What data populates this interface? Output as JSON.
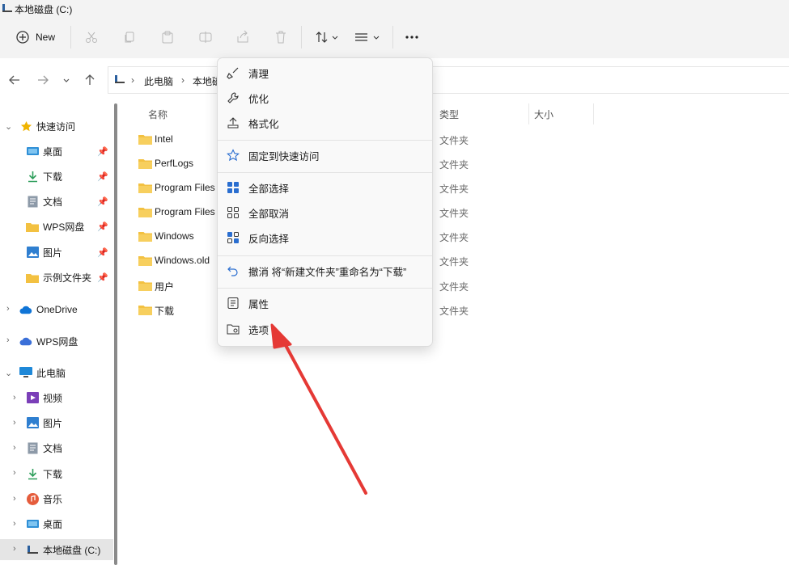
{
  "window": {
    "title": "本地磁盘 (C:)"
  },
  "toolbar": {
    "new_label": "New",
    "icons": [
      "add-icon",
      "cut-icon",
      "copy-icon",
      "paste-icon",
      "rename-icon",
      "share-icon",
      "delete-icon",
      "sort-icon",
      "view-icon",
      "more-icon"
    ]
  },
  "address": {
    "crumbs": [
      "此电脑",
      "本地磁"
    ]
  },
  "sidebar": {
    "quick_access": {
      "label": "快速访问",
      "items": [
        {
          "label": "桌面",
          "icon": "desktop-icon"
        },
        {
          "label": "下载",
          "icon": "download-icon"
        },
        {
          "label": "文档",
          "icon": "document-icon"
        },
        {
          "label": "WPS网盘",
          "icon": "folder-icon"
        },
        {
          "label": "图片",
          "icon": "pictures-icon"
        },
        {
          "label": "示例文件夹",
          "icon": "folder-icon"
        }
      ]
    },
    "onedrive": "OneDrive",
    "wps": "WPS网盘",
    "this_pc": {
      "label": "此电脑",
      "items": [
        {
          "label": "视频",
          "icon": "video-icon"
        },
        {
          "label": "图片",
          "icon": "pictures-icon"
        },
        {
          "label": "文档",
          "icon": "document-icon"
        },
        {
          "label": "下载",
          "icon": "download-icon"
        },
        {
          "label": "音乐",
          "icon": "music-icon"
        },
        {
          "label": "桌面",
          "icon": "desktop-icon"
        },
        {
          "label": "本地磁盘 (C:)",
          "icon": "drive-icon"
        }
      ]
    }
  },
  "columns": {
    "name": "名称",
    "type": "类型",
    "size": "大小"
  },
  "files": [
    {
      "name": "Intel",
      "type": "文件夹"
    },
    {
      "name": "PerfLogs",
      "type": "文件夹"
    },
    {
      "name": "Program Files",
      "type": "文件夹"
    },
    {
      "name": "Program Files",
      "type": "文件夹"
    },
    {
      "name": "Windows",
      "type": "文件夹"
    },
    {
      "name": "Windows.old",
      "type": "文件夹"
    },
    {
      "name": "用户",
      "type": "文件夹"
    },
    {
      "name": "下载",
      "type": "文件夹"
    }
  ],
  "menu": {
    "items": [
      {
        "label": "清理",
        "icon": "broom-icon"
      },
      {
        "label": "优化",
        "icon": "wrench-icon"
      },
      {
        "label": "格式化",
        "icon": "format-icon"
      },
      {
        "label": "固定到快速访问",
        "icon": "star-icon"
      },
      {
        "label": "全部选择",
        "icon": "select-all-icon"
      },
      {
        "label": "全部取消",
        "icon": "select-none-icon"
      },
      {
        "label": "反向选择",
        "icon": "invert-selection-icon"
      },
      {
        "label": "撤消 将“新建文件夹”重命名为“下载”",
        "icon": "undo-icon"
      },
      {
        "label": "属性",
        "icon": "properties-icon"
      },
      {
        "label": "选项",
        "icon": "options-icon"
      }
    ]
  },
  "colors": {
    "folder": "#f3c141",
    "annotation_arrow": "#e53935",
    "star": "#f0b400"
  }
}
